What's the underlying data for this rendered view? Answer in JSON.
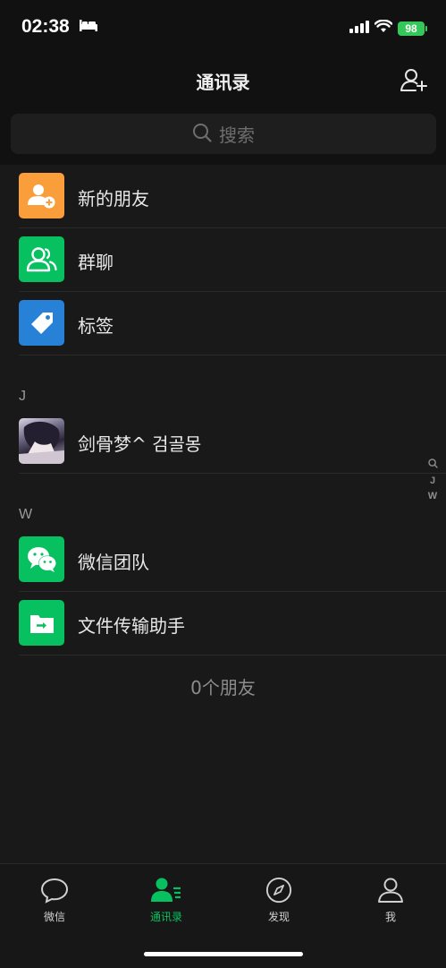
{
  "status": {
    "time": "02:38",
    "battery": "98"
  },
  "nav": {
    "title": "通讯录"
  },
  "search": {
    "placeholder": "搜索"
  },
  "top_items": [
    {
      "label": "新的朋友",
      "color": "#fa9d3b"
    },
    {
      "label": "群聊",
      "color": "#07c160"
    },
    {
      "label": "标签",
      "color": "#2782d7"
    }
  ],
  "sections": [
    {
      "letter": "J",
      "contacts": [
        {
          "name": "剑骨梦^ 검골몽"
        }
      ]
    },
    {
      "letter": "W",
      "contacts": [
        {
          "name": "微信团队"
        },
        {
          "name": "文件传输助手"
        }
      ]
    }
  ],
  "friend_count": "0个朋友",
  "index_bar": [
    "J",
    "W"
  ],
  "tabs": [
    {
      "label": "微信",
      "active": false
    },
    {
      "label": "通讯录",
      "active": true
    },
    {
      "label": "发现",
      "active": false
    },
    {
      "label": "我",
      "active": false
    }
  ],
  "colors": {
    "accent": "#07c160",
    "background": "#191919"
  }
}
